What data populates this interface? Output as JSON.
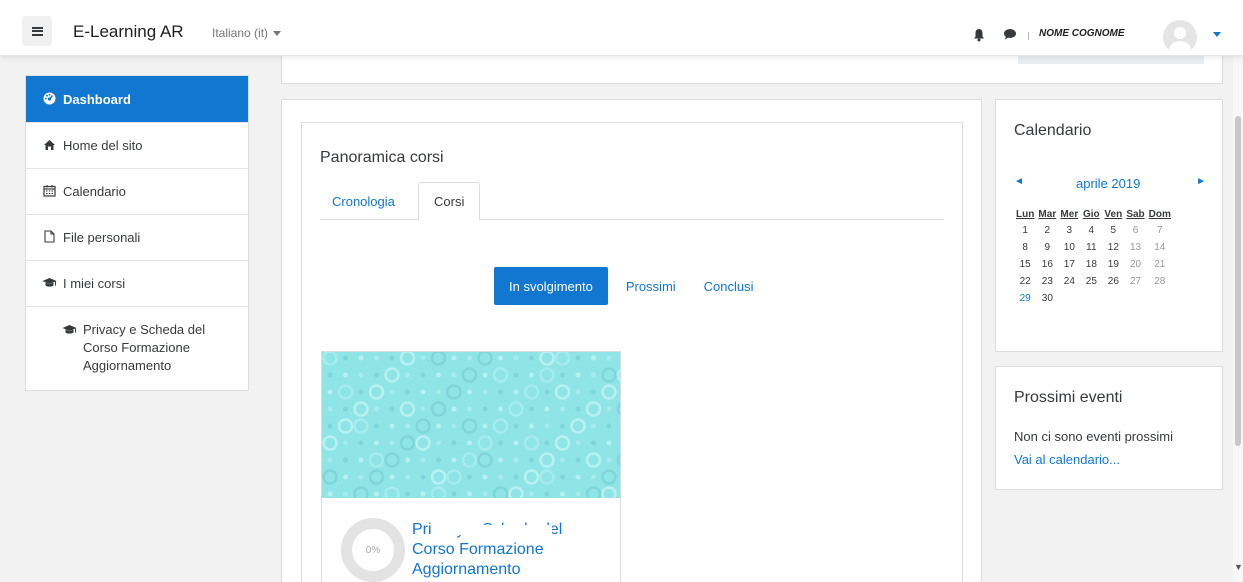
{
  "navbar": {
    "site_name": "E-Learning AR",
    "language": "Italiano (it)",
    "user_name": "NOME COGNOME"
  },
  "drawer": {
    "items": [
      {
        "label": "Dashboard",
        "icon": "dashboard-icon",
        "active": true
      },
      {
        "label": "Home del sito",
        "icon": "home-icon"
      },
      {
        "label": "Calendario",
        "icon": "calendar-icon"
      },
      {
        "label": "File personali",
        "icon": "file-icon"
      },
      {
        "label": "I miei corsi",
        "icon": "graduation-cap-icon"
      },
      {
        "label": "Privacy e Scheda del Corso Formazione Aggiornamento",
        "icon": "graduation-cap-icon"
      }
    ]
  },
  "overview": {
    "title": "Panoramica corsi",
    "tabs": [
      "Cronologia",
      "Corsi"
    ],
    "active_tab": "Corsi",
    "filters": [
      "In svolgimento",
      "Prossimi",
      "Conclusi"
    ],
    "active_filter": "In svolgimento",
    "course": {
      "name": "Privacy e Scheda del Corso Formazione Aggiornamento",
      "progress_label": "0%",
      "progress": 0
    }
  },
  "calendar": {
    "title": "Calendario",
    "prev": "◄",
    "month": "aprile 2019",
    "next": "►",
    "weekdays": [
      "Lun",
      "Mar",
      "Mer",
      "Gio",
      "Ven",
      "Sab",
      "Dom"
    ],
    "weeks": [
      [
        "1",
        "2",
        "3",
        "4",
        "5",
        "6",
        "7"
      ],
      [
        "8",
        "9",
        "10",
        "11",
        "12",
        "13",
        "14"
      ],
      [
        "15",
        "16",
        "17",
        "18",
        "19",
        "20",
        "21"
      ],
      [
        "22",
        "23",
        "24",
        "25",
        "26",
        "27",
        "28"
      ],
      [
        "29",
        "30",
        "",
        "",
        "",
        "",
        ""
      ]
    ],
    "today": "29"
  },
  "events": {
    "title": "Prossimi eventi",
    "empty_text": "Non ci sono eventi prossimi",
    "link": "Vai al calendario..."
  },
  "colors": {
    "accent": "#1177d1",
    "course_image": "#8fe4e6"
  }
}
